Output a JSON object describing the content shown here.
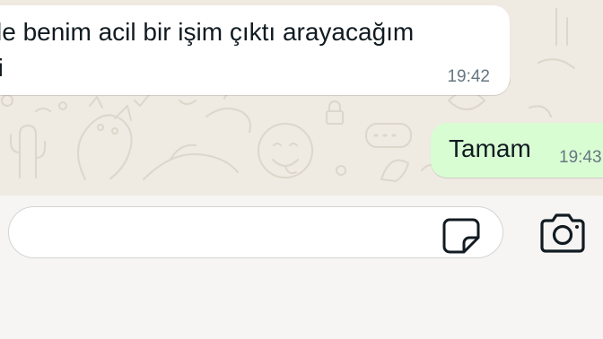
{
  "chat": {
    "messages": [
      {
        "direction": "incoming",
        "text": "kle benim acil bir işim çıktı arayacağım\nni",
        "line1": "kle benim acil bir işim çıktı arayacağım",
        "line2": "ni",
        "time": "19:42"
      },
      {
        "direction": "outgoing",
        "text": "Tamam",
        "time": "19:43"
      }
    ]
  },
  "composer": {
    "input_value": "",
    "input_placeholder": "",
    "sticker_icon": "sticker-icon",
    "camera_icon": "camera-icon"
  },
  "colors": {
    "chat_background": "#efeae2",
    "incoming_bubble": "#ffffff",
    "outgoing_bubble": "#d9fdd3",
    "timestamp": "#667781",
    "text": "#111b21",
    "composer_background": "#f6f5f3"
  }
}
